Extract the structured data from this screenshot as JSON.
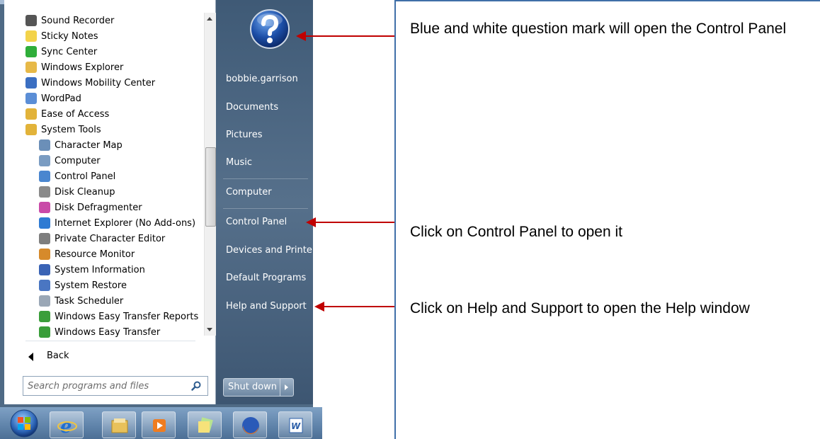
{
  "programs": [
    {
      "label": "Sound Recorder",
      "color": "#555555",
      "sub": false
    },
    {
      "label": "Sticky Notes",
      "color": "#f3d34a",
      "sub": false
    },
    {
      "label": "Sync Center",
      "color": "#2fae3a",
      "sub": false
    },
    {
      "label": "Windows Explorer",
      "color": "#e7b948",
      "sub": false
    },
    {
      "label": "Windows Mobility Center",
      "color": "#3b6fc2",
      "sub": false
    },
    {
      "label": "WordPad",
      "color": "#5b8ed6",
      "sub": false
    },
    {
      "label": "Ease of Access",
      "color": "#e2b33a",
      "sub": false
    },
    {
      "label": "System Tools",
      "color": "#e2b33a",
      "sub": false
    },
    {
      "label": "Character Map",
      "color": "#6b8fb8",
      "sub": true
    },
    {
      "label": "Computer",
      "color": "#7a9cc2",
      "sub": true
    },
    {
      "label": "Control Panel",
      "color": "#4a86cf",
      "sub": true
    },
    {
      "label": "Disk Cleanup",
      "color": "#8a8a8a",
      "sub": true
    },
    {
      "label": "Disk Defragmenter",
      "color": "#c94aa8",
      "sub": true
    },
    {
      "label": "Internet Explorer (No Add-ons)",
      "color": "#2f7bd3",
      "sub": true
    },
    {
      "label": "Private Character Editor",
      "color": "#7e7e7e",
      "sub": true
    },
    {
      "label": "Resource Monitor",
      "color": "#d68a2b",
      "sub": true
    },
    {
      "label": "System Information",
      "color": "#3a63b5",
      "sub": true
    },
    {
      "label": "System Restore",
      "color": "#4a76c2",
      "sub": true
    },
    {
      "label": "Task Scheduler",
      "color": "#9aa7b6",
      "sub": true
    },
    {
      "label": "Windows Easy Transfer Reports",
      "color": "#3a9e3a",
      "sub": true
    },
    {
      "label": "Windows Easy Transfer",
      "color": "#3a9e3a",
      "sub": true
    }
  ],
  "back_label": "Back",
  "search_placeholder": "Search programs and files",
  "right_pane": {
    "items": [
      "bobbie.garrison",
      "Documents",
      "Pictures",
      "Music",
      "Computer",
      "Control Panel",
      "Devices and Printers",
      "Default Programs",
      "Help and Support"
    ],
    "shutdown_label": "Shut down"
  },
  "annotations": {
    "question_mark": "Blue and white question mark will open the Control Panel",
    "control_panel": "Click on Control Panel to open it",
    "help_support": "Click on Help and Support to open the Help window"
  },
  "colors": {
    "arrow": "#c00000",
    "box_border": "#3f6fa8",
    "menu_bg": "#4f6a85"
  },
  "taskbar_icons": [
    "windows-orb-icon",
    "internet-explorer-icon",
    "file-explorer-icon",
    "media-player-icon",
    "sticky-notes-icon",
    "firefox-icon",
    "word-icon"
  ]
}
